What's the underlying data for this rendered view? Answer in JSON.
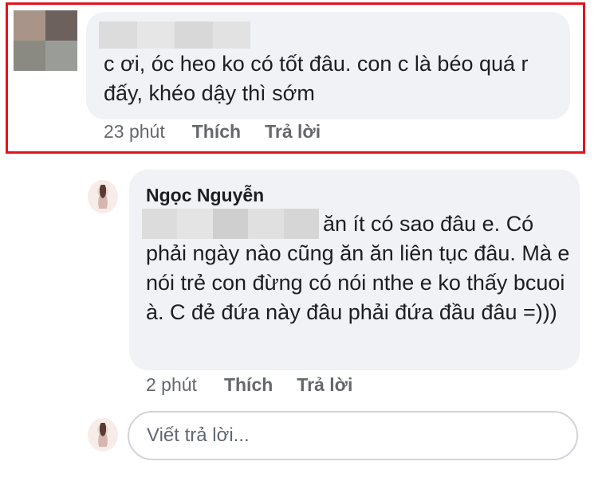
{
  "comment1": {
    "text": "c ơi, óc heo ko có tốt đâu. con c là béo quá r đấy, khéo dậy thì sớm",
    "time": "23 phút",
    "like_label": "Thích",
    "reply_label": "Trả lời"
  },
  "comment2": {
    "author": "Ngọc Nguyễn",
    "text_line1": "ăn ít có sao đâu e.",
    "text_rest": "Có phải ngày nào cũng ăn ăn liên tục đâu. Mà e nói trẻ con đừng có nói nthe e ko thấy bcuoi à. C đẻ đứa này đâu phải đứa đầu đâu =)))",
    "time": "2 phút",
    "like_label": "Thích",
    "reply_label": "Trả lời"
  },
  "reply_input": {
    "placeholder": "Viết trả lời..."
  },
  "colors": {
    "highlight": "#e0131f",
    "bubble": "#f0f2f5",
    "meta_text": "#65676b"
  }
}
